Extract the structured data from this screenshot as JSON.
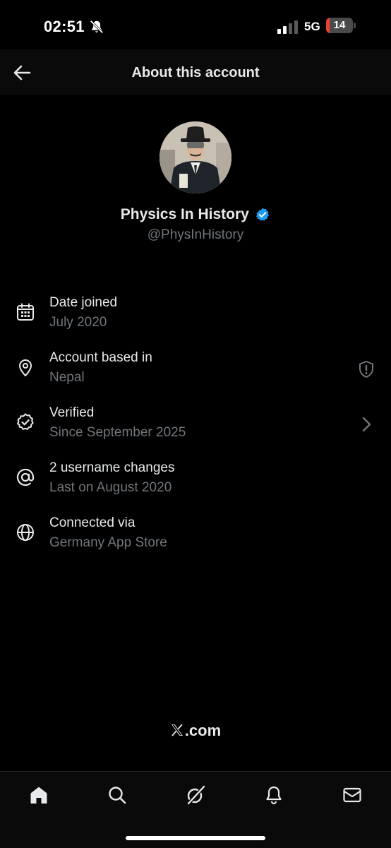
{
  "status_bar": {
    "time": "02:51",
    "network": "5G",
    "battery_level": "14",
    "battery_fraction": 0.14
  },
  "header": {
    "title": "About this account",
    "back_icon": "arrow-left-icon"
  },
  "profile": {
    "display_name": "Physics In History",
    "handle": "@PhysInHistory",
    "verified": true,
    "verified_color": "#1d9bf0"
  },
  "info_items": [
    {
      "icon": "calendar-icon",
      "title": "Date joined",
      "subtitle": "July 2020"
    },
    {
      "icon": "location-pin-icon",
      "title": "Account based in",
      "subtitle": "Nepal",
      "trailing": "shield-info-icon"
    },
    {
      "icon": "verified-outline-icon",
      "title": "Verified",
      "subtitle": "Since September 2025",
      "trailing": "chevron-right-icon"
    },
    {
      "icon": "at-sign-icon",
      "title": "2 username changes",
      "subtitle": "Last on August 2020"
    },
    {
      "icon": "globe-icon",
      "title": "Connected via",
      "subtitle": "Germany App Store"
    }
  ],
  "footer": {
    "brand_suffix": ".com"
  },
  "tab_bar": {
    "tabs": [
      "home-icon",
      "search-icon",
      "grok-icon",
      "bell-icon",
      "mail-icon"
    ],
    "active": "home-icon"
  },
  "colors": {
    "background": "#000000",
    "primary_text": "#e7e9ea",
    "secondary_text": "#71767b",
    "accent": "#1d9bf0"
  }
}
